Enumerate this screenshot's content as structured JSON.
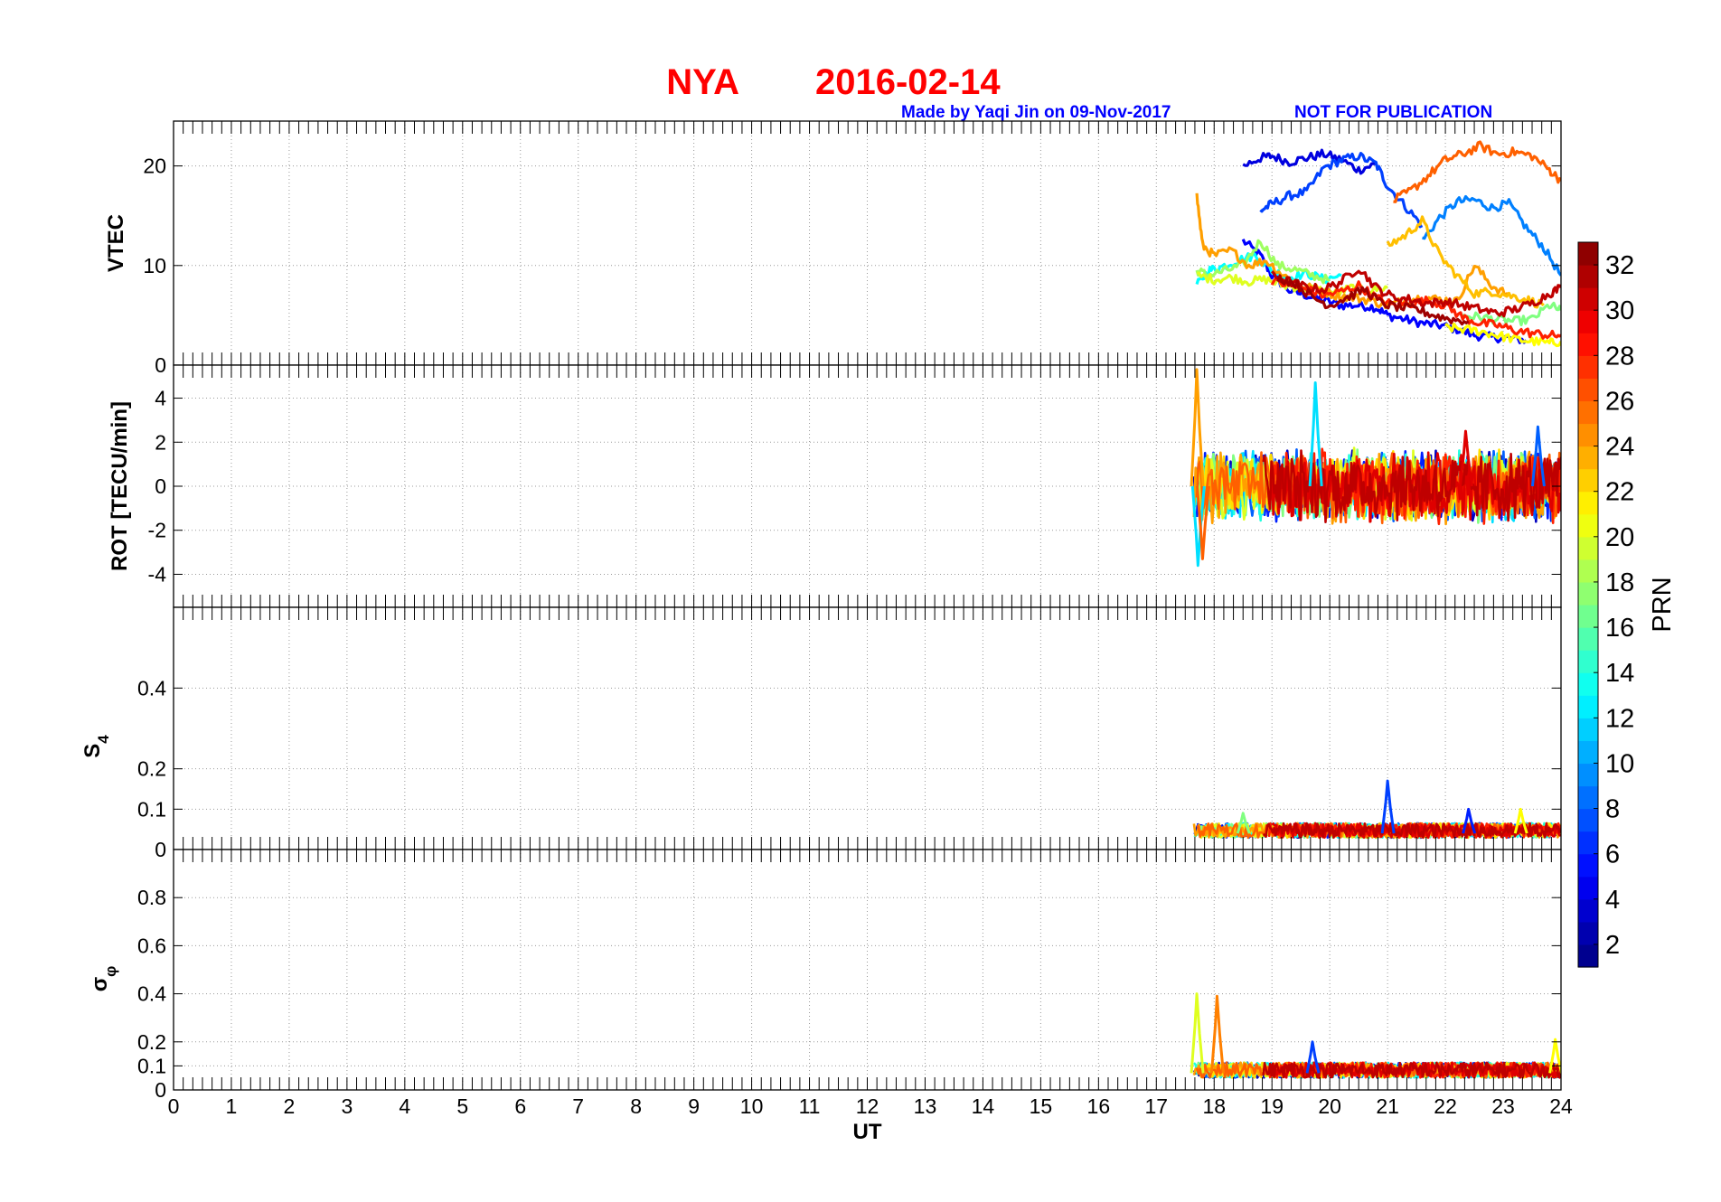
{
  "title": {
    "station": "NYA",
    "date": "2016-02-14",
    "color": "#ff0000"
  },
  "credit": {
    "made_by": "Made by Yaqi Jin on 09-Nov-2017",
    "notice": "NOT FOR PUBLICATION",
    "color": "#0000ff"
  },
  "colorbar": {
    "label": "PRN",
    "ticks": [
      "2",
      "4",
      "6",
      "8",
      "10",
      "12",
      "14",
      "16",
      "18",
      "20",
      "22",
      "24",
      "26",
      "28",
      "30",
      "32"
    ],
    "range": [
      1,
      33
    ],
    "colormap": "jet"
  },
  "chart_data": [
    {
      "type": "line",
      "panel": "vtec",
      "ylabel": "VTEC",
      "ylim": [
        0,
        24.5
      ],
      "yticks": [
        "0",
        "10",
        "20"
      ],
      "ytick_values": [
        0,
        10,
        20
      ],
      "xlim": [
        0,
        24
      ],
      "grid": true,
      "series": [
        {
          "prn": 5,
          "x": [
            18.5,
            18.8,
            19.0,
            19.3,
            19.6,
            19.9,
            20.2,
            20.5,
            20.8,
            21.0,
            21.3,
            21.6,
            21.9,
            22.2,
            22.5,
            22.8,
            23.1,
            23.4
          ],
          "values": [
            12.5,
            11.0,
            9.0,
            7.5,
            7.0,
            6.5,
            6.0,
            6.0,
            5.8,
            5.0,
            4.6,
            4.2,
            4.0,
            3.6,
            3.0,
            2.8,
            2.7,
            2.5
          ]
        },
        {
          "prn": 4,
          "x": [
            18.5,
            18.8,
            19.0,
            19.3,
            19.6,
            19.9,
            20.2,
            20.5,
            20.8
          ],
          "values": [
            20.0,
            20.8,
            21.0,
            20.4,
            20.8,
            21.2,
            20.6,
            19.6,
            20.2
          ]
        },
        {
          "prn": 7,
          "x": [
            18.8,
            19.0,
            19.3,
            19.6,
            19.9,
            20.2,
            20.5,
            20.8,
            21.0,
            21.3,
            21.6
          ],
          "values": [
            15.5,
            16.2,
            17.0,
            17.4,
            19.8,
            20.6,
            21.0,
            20.2,
            18.0,
            16.0,
            14.0
          ]
        },
        {
          "prn": 9,
          "x": [
            21.6,
            21.9,
            22.2,
            22.5,
            22.8,
            23.1,
            23.4,
            23.7,
            24.0
          ],
          "values": [
            12.5,
            14.8,
            16.4,
            16.6,
            15.8,
            16.2,
            13.8,
            11.8,
            9.0
          ]
        },
        {
          "prn": 13,
          "x": [
            17.7,
            17.9,
            18.1,
            18.4,
            18.7,
            19.0,
            19.3,
            19.6,
            19.9,
            20.2
          ],
          "values": [
            8.0,
            9.5,
            9.8,
            10.5,
            11.0,
            9.5,
            8.8,
            9.2,
            8.6,
            9.0
          ]
        },
        {
          "prn": 18,
          "x": [
            17.7,
            17.9,
            18.2,
            18.5,
            18.8,
            19.1,
            19.4,
            19.7,
            20.0
          ],
          "values": [
            9.5,
            9.0,
            9.5,
            10.0,
            12.5,
            10.0,
            9.6,
            9.0,
            8.5
          ]
        },
        {
          "prn": 20,
          "x": [
            17.7,
            18.0,
            18.3,
            18.6,
            18.9,
            19.2,
            19.5,
            19.8,
            20.1,
            20.4,
            20.7,
            21.0
          ],
          "values": [
            9.0,
            8.6,
            8.8,
            8.4,
            8.6,
            8.0,
            7.8,
            7.6,
            7.2,
            7.8,
            7.5,
            7.8
          ]
        },
        {
          "prn": 17,
          "x": [
            22.3,
            22.6,
            22.9,
            23.2,
            23.5,
            23.8,
            24.0
          ],
          "values": [
            5.0,
            4.8,
            4.6,
            4.4,
            4.6,
            6.0,
            5.5
          ]
        },
        {
          "prn": 21,
          "x": [
            22.0,
            22.3,
            22.6,
            22.9,
            23.2,
            23.5,
            23.8,
            24.0
          ],
          "values": [
            3.8,
            3.6,
            3.4,
            3.0,
            2.6,
            2.4,
            2.2,
            2.4
          ]
        },
        {
          "prn": 24,
          "x": [
            17.7,
            17.8,
            18.0,
            18.3,
            18.6,
            18.9,
            19.2,
            19.5,
            19.8,
            20.1,
            20.4,
            20.7,
            21.0,
            21.3,
            21.6,
            21.9,
            22.2,
            22.5,
            22.8,
            23.1
          ],
          "values": [
            17.0,
            12.0,
            11.0,
            11.5,
            10.0,
            10.5,
            9.0,
            8.0,
            7.6,
            7.0,
            6.8,
            6.5,
            6.0,
            6.5,
            6.8,
            6.6,
            6.4,
            10.0,
            8.0,
            7.0
          ]
        },
        {
          "prn": 23,
          "x": [
            21.0,
            21.3,
            21.6,
            21.9,
            22.2,
            22.5,
            22.8,
            23.1,
            23.4,
            23.7
          ],
          "values": [
            12.0,
            13.0,
            14.5,
            11.0,
            9.0,
            7.2,
            7.4,
            7.0,
            6.6,
            6.0
          ]
        },
        {
          "prn": 26,
          "x": [
            21.1,
            21.4,
            21.7,
            22.0,
            22.3,
            22.6,
            22.9,
            23.2,
            23.5,
            23.8,
            24.0
          ],
          "values": [
            16.5,
            17.5,
            19.0,
            20.6,
            21.2,
            22.0,
            21.2,
            21.4,
            21.0,
            19.6,
            18.5
          ]
        },
        {
          "prn": 28,
          "x": [
            19.0,
            19.3,
            19.6,
            19.9,
            20.2,
            20.5,
            20.8,
            21.1,
            21.4,
            21.7,
            22.0,
            22.3,
            22.6,
            22.9,
            23.2,
            23.5,
            23.8,
            24.0
          ],
          "values": [
            8.5,
            8.0,
            7.6,
            7.0,
            7.4,
            8.0,
            6.8,
            6.0,
            6.2,
            6.5,
            6.0,
            4.8,
            4.2,
            4.0,
            3.5,
            3.2,
            3.0,
            3.0
          ]
        },
        {
          "prn": 31,
          "x": [
            19.0,
            19.3,
            19.6,
            19.9,
            20.2,
            20.5,
            20.8,
            21.1,
            21.4,
            21.7,
            22.0,
            22.3,
            22.6,
            22.9,
            23.2,
            23.5,
            23.8,
            24.0
          ],
          "values": [
            9.0,
            8.4,
            7.8,
            7.6,
            8.4,
            9.8,
            7.8,
            6.8,
            6.6,
            6.2,
            6.4,
            6.0,
            5.6,
            5.2,
            5.6,
            6.2,
            7.2,
            7.8
          ]
        },
        {
          "prn": 32,
          "x": [
            19.1,
            19.4,
            19.7,
            20.0,
            20.3,
            20.6,
            20.9,
            21.2,
            21.5,
            21.8,
            22.1,
            22.4
          ],
          "values": [
            8.8,
            8.2,
            6.8,
            6.0,
            6.8,
            7.6,
            6.2,
            5.8,
            5.6,
            5.0,
            4.6,
            4.4
          ]
        }
      ]
    },
    {
      "type": "line",
      "panel": "rot",
      "ylabel": "ROT [TECU/min]",
      "ylim": [
        -5.5,
        5.5
      ],
      "yticks": [
        "-4",
        "-2",
        "0",
        "2",
        "4"
      ],
      "ytick_values": [
        -4,
        -2,
        0,
        2,
        4
      ],
      "xlim": [
        0,
        24
      ],
      "grid": true,
      "x_start": 17.65,
      "x_end": 24.0,
      "noise_amplitude": 1.5,
      "spikes": [
        {
          "x": 17.7,
          "y": 5.3,
          "prn": 24
        },
        {
          "x": 17.72,
          "y": -3.6,
          "prn": 12
        },
        {
          "x": 17.8,
          "y": -3.3,
          "prn": 26
        },
        {
          "x": 19.75,
          "y": 4.7,
          "prn": 12
        },
        {
          "x": 23.6,
          "y": 2.7,
          "prn": 8
        },
        {
          "x": 22.35,
          "y": 2.5,
          "prn": 30
        }
      ]
    },
    {
      "type": "line",
      "panel": "s4",
      "ylabel": "S4",
      "ylim": [
        0,
        0.6
      ],
      "yticks": [
        "0",
        "0.1",
        "0.2",
        "0.4"
      ],
      "ytick_values": [
        0,
        0.1,
        0.2,
        0.4
      ],
      "xlim": [
        0,
        24
      ],
      "grid": true,
      "x_start": 17.65,
      "x_end": 24.0,
      "baseline": 0.04,
      "spikes": [
        {
          "x": 21.0,
          "y": 0.17,
          "prn": 7
        },
        {
          "x": 22.4,
          "y": 0.1,
          "prn": 6
        },
        {
          "x": 23.3,
          "y": 0.1,
          "prn": 21
        },
        {
          "x": 18.5,
          "y": 0.09,
          "prn": 17
        }
      ]
    },
    {
      "type": "line",
      "panel": "sigma_phi",
      "ylabel": "σφ",
      "ylim": [
        0,
        1
      ],
      "yticks": [
        "0",
        "0.1",
        "0.2",
        "0.4",
        "0.6",
        "0.8"
      ],
      "ytick_values": [
        0,
        0.1,
        0.2,
        0.4,
        0.6,
        0.8
      ],
      "xlim": [
        0,
        24
      ],
      "xlabel": "UT",
      "xticks": [
        "0",
        "1",
        "2",
        "3",
        "4",
        "5",
        "6",
        "7",
        "8",
        "9",
        "10",
        "11",
        "12",
        "13",
        "14",
        "15",
        "16",
        "17",
        "18",
        "19",
        "20",
        "21",
        "22",
        "23",
        "24"
      ],
      "grid": true,
      "x_start": 17.65,
      "x_end": 24.0,
      "baseline": 0.07,
      "spikes": [
        {
          "x": 17.7,
          "y": 0.4,
          "prn": 20
        },
        {
          "x": 18.05,
          "y": 0.39,
          "prn": 25
        },
        {
          "x": 19.7,
          "y": 0.2,
          "prn": 7
        },
        {
          "x": 23.9,
          "y": 0.21,
          "prn": 21
        }
      ]
    }
  ]
}
